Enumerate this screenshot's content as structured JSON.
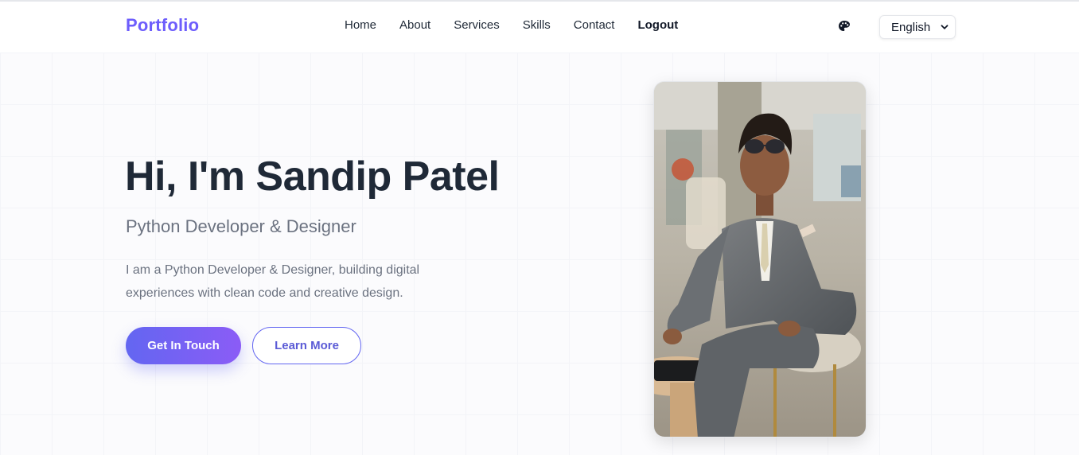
{
  "header": {
    "logo": "Portfolio",
    "nav": [
      {
        "label": "Home"
      },
      {
        "label": "About"
      },
      {
        "label": "Services"
      },
      {
        "label": "Skills"
      },
      {
        "label": "Contact"
      },
      {
        "label": "Logout"
      }
    ],
    "theme_icon": "palette-icon",
    "language": {
      "selected": "English"
    }
  },
  "hero": {
    "title": "Hi, I'm Sandip Patel",
    "subtitle": "Python Developer & Designer",
    "description": "I am a Python Developer & Designer, building digital experiences with clean code and creative design.",
    "primary_button": "Get In Touch",
    "secondary_button": "Learn More"
  },
  "colors": {
    "brand": "#6d5dfc",
    "accent_gradient": [
      "#6366f1",
      "#8b5cf6"
    ],
    "text_dark": "#1f2937",
    "text_muted": "#6b7280"
  }
}
